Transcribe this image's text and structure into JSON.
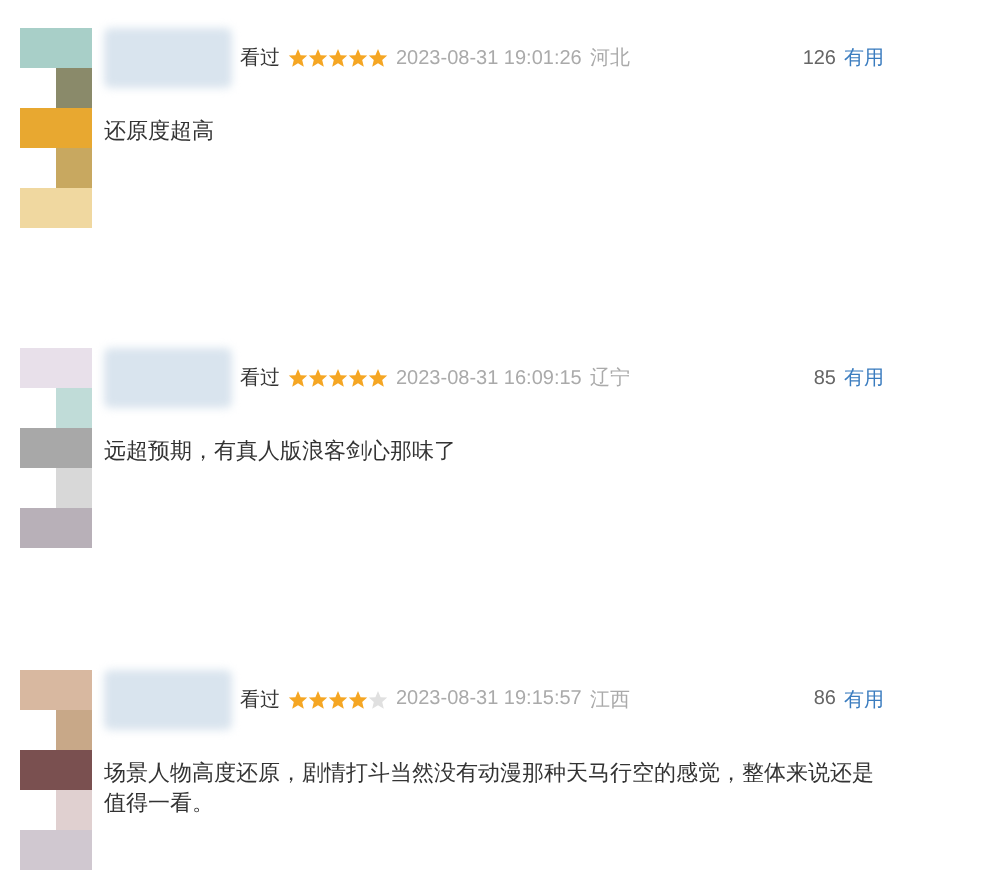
{
  "comments": [
    {
      "status": "看过",
      "stars": 5,
      "time": "2023-08-31 19:01:26",
      "location": "河北",
      "votes": "126",
      "vote_label": "有用",
      "text": "还原度超高"
    },
    {
      "status": "看过",
      "stars": 5,
      "time": "2023-08-31 16:09:15",
      "location": "辽宁",
      "votes": "85",
      "vote_label": "有用",
      "text": "远超预期，有真人版浪客剑心那味了"
    },
    {
      "status": "看过",
      "stars": 4,
      "time": "2023-08-31 19:15:57",
      "location": "江西",
      "votes": "86",
      "vote_label": "有用",
      "text": "场景人物高度还原，剧情打斗当然没有动漫那种天马行空的感觉，整体来说还是值得一看。"
    }
  ]
}
